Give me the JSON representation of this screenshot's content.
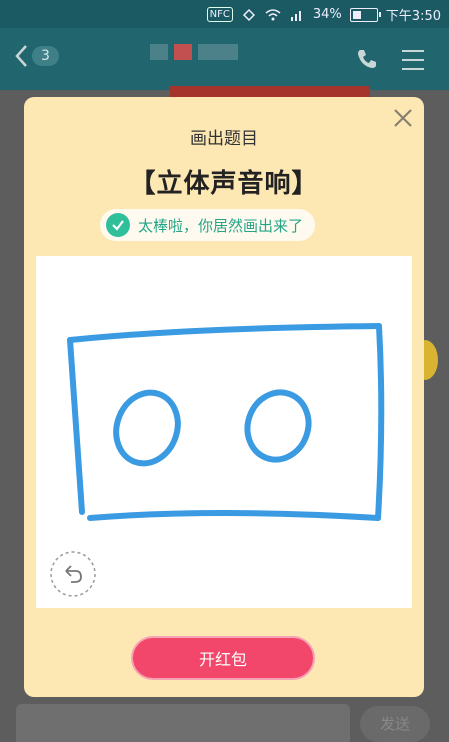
{
  "status_bar": {
    "nfc": "NFC",
    "battery": "34%",
    "time": "下午3:50"
  },
  "header": {
    "unread_count": "3"
  },
  "modal": {
    "title": "画出题目",
    "topic": "【立体声音响】",
    "success_text": "太棒啦，你居然画出来了",
    "open_button": "开红包"
  },
  "input_bar": {
    "send_label": "发送"
  },
  "colors": {
    "modal_bg": "#fde8b4",
    "accent_green": "#2fbf9a",
    "button_red": "#f2466a",
    "stroke_blue": "#3a9be2"
  }
}
